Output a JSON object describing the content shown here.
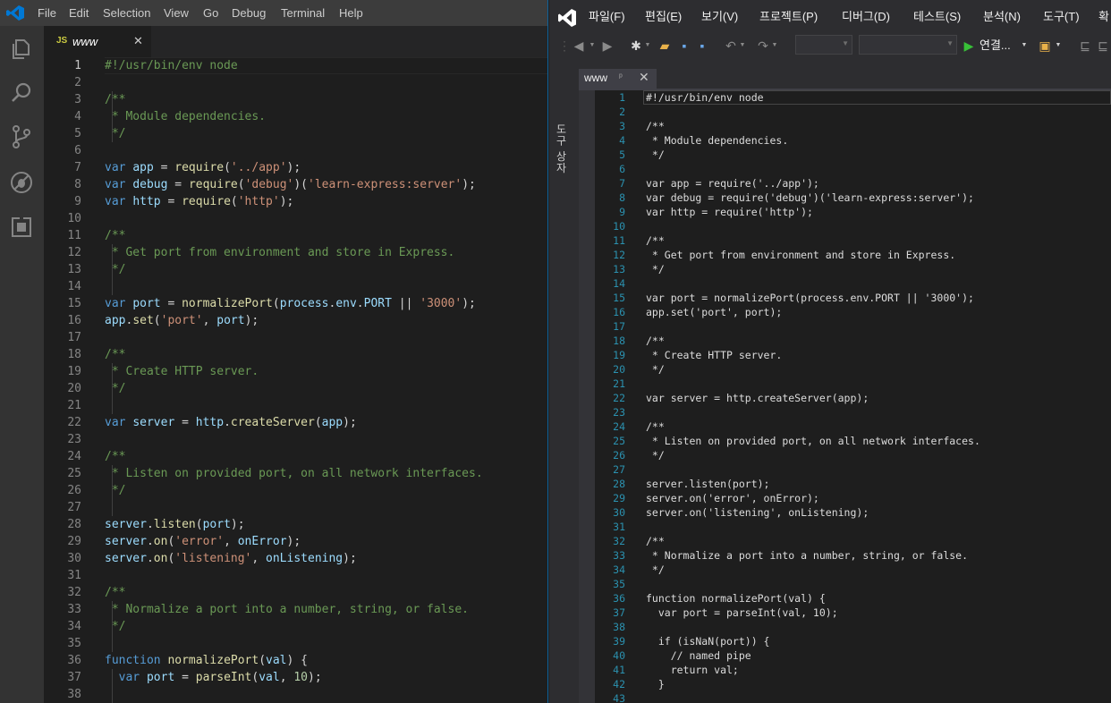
{
  "vscode": {
    "menu": [
      "File",
      "Edit",
      "Selection",
      "View",
      "Go",
      "Debug",
      "Terminal",
      "Help"
    ],
    "activity_icons": [
      "explorer-icon",
      "search-icon",
      "source-control-icon",
      "debug-icon",
      "extensions-icon"
    ],
    "tab": {
      "lang_badge": "JS",
      "name": "www",
      "close": "✕"
    },
    "current_line": 1,
    "lines": [
      {
        "n": "1",
        "c": [
          [
            "#!/usr/bin/env node",
            "#6a9955"
          ]
        ]
      },
      {
        "n": "2",
        "c": []
      },
      {
        "n": "3",
        "c": [
          [
            "/**",
            "#6a9955"
          ]
        ]
      },
      {
        "n": "4",
        "c": [
          [
            " * Module dependencies.",
            "#6a9955"
          ]
        ]
      },
      {
        "n": "5",
        "c": [
          [
            " */",
            "#6a9955"
          ]
        ]
      },
      {
        "n": "6",
        "c": []
      },
      {
        "n": "7",
        "c": [
          [
            "var",
            "#569cd6"
          ],
          [
            " ",
            "#d4d4d4"
          ],
          [
            "app",
            "#9cdcfe"
          ],
          [
            " = ",
            "#d4d4d4"
          ],
          [
            "require",
            "#dcdcaa"
          ],
          [
            "(",
            "#d4d4d4"
          ],
          [
            "'../app'",
            "#ce9178"
          ],
          [
            ");",
            "#d4d4d4"
          ]
        ]
      },
      {
        "n": "8",
        "c": [
          [
            "var",
            "#569cd6"
          ],
          [
            " ",
            "#d4d4d4"
          ],
          [
            "debug",
            "#9cdcfe"
          ],
          [
            " = ",
            "#d4d4d4"
          ],
          [
            "require",
            "#dcdcaa"
          ],
          [
            "(",
            "#d4d4d4"
          ],
          [
            "'debug'",
            "#ce9178"
          ],
          [
            ")(",
            "#d4d4d4"
          ],
          [
            "'learn-express:server'",
            "#ce9178"
          ],
          [
            ");",
            "#d4d4d4"
          ]
        ]
      },
      {
        "n": "9",
        "c": [
          [
            "var",
            "#569cd6"
          ],
          [
            " ",
            "#d4d4d4"
          ],
          [
            "http",
            "#9cdcfe"
          ],
          [
            " = ",
            "#d4d4d4"
          ],
          [
            "require",
            "#dcdcaa"
          ],
          [
            "(",
            "#d4d4d4"
          ],
          [
            "'http'",
            "#ce9178"
          ],
          [
            ");",
            "#d4d4d4"
          ]
        ]
      },
      {
        "n": "10",
        "c": []
      },
      {
        "n": "11",
        "c": [
          [
            "/**",
            "#6a9955"
          ]
        ]
      },
      {
        "n": "12",
        "c": [
          [
            " * Get port from environment and store in Express.",
            "#6a9955"
          ]
        ]
      },
      {
        "n": "13",
        "c": [
          [
            " */",
            "#6a9955"
          ]
        ]
      },
      {
        "n": "14",
        "c": []
      },
      {
        "n": "15",
        "c": [
          [
            "var",
            "#569cd6"
          ],
          [
            " ",
            "#d4d4d4"
          ],
          [
            "port",
            "#9cdcfe"
          ],
          [
            " = ",
            "#d4d4d4"
          ],
          [
            "normalizePort",
            "#dcdcaa"
          ],
          [
            "(",
            "#d4d4d4"
          ],
          [
            "process",
            "#9cdcfe"
          ],
          [
            ".",
            "#d4d4d4"
          ],
          [
            "env",
            "#9cdcfe"
          ],
          [
            ".",
            "#d4d4d4"
          ],
          [
            "PORT",
            "#9cdcfe"
          ],
          [
            " || ",
            "#d4d4d4"
          ],
          [
            "'3000'",
            "#ce9178"
          ],
          [
            ");",
            "#d4d4d4"
          ]
        ]
      },
      {
        "n": "16",
        "c": [
          [
            "app",
            "#9cdcfe"
          ],
          [
            ".",
            "#d4d4d4"
          ],
          [
            "set",
            "#dcdcaa"
          ],
          [
            "(",
            "#d4d4d4"
          ],
          [
            "'port'",
            "#ce9178"
          ],
          [
            ", ",
            "#d4d4d4"
          ],
          [
            "port",
            "#9cdcfe"
          ],
          [
            ");",
            "#d4d4d4"
          ]
        ]
      },
      {
        "n": "17",
        "c": []
      },
      {
        "n": "18",
        "c": [
          [
            "/**",
            "#6a9955"
          ]
        ]
      },
      {
        "n": "19",
        "c": [
          [
            " * Create HTTP server.",
            "#6a9955"
          ]
        ]
      },
      {
        "n": "20",
        "c": [
          [
            " */",
            "#6a9955"
          ]
        ]
      },
      {
        "n": "21",
        "c": []
      },
      {
        "n": "22",
        "c": [
          [
            "var",
            "#569cd6"
          ],
          [
            " ",
            "#d4d4d4"
          ],
          [
            "server",
            "#9cdcfe"
          ],
          [
            " = ",
            "#d4d4d4"
          ],
          [
            "http",
            "#9cdcfe"
          ],
          [
            ".",
            "#d4d4d4"
          ],
          [
            "createServer",
            "#dcdcaa"
          ],
          [
            "(",
            "#d4d4d4"
          ],
          [
            "app",
            "#9cdcfe"
          ],
          [
            ");",
            "#d4d4d4"
          ]
        ]
      },
      {
        "n": "23",
        "c": []
      },
      {
        "n": "24",
        "c": [
          [
            "/**",
            "#6a9955"
          ]
        ]
      },
      {
        "n": "25",
        "c": [
          [
            " * Listen on provided port, on all network interfaces.",
            "#6a9955"
          ]
        ]
      },
      {
        "n": "26",
        "c": [
          [
            " */",
            "#6a9955"
          ]
        ]
      },
      {
        "n": "27",
        "c": []
      },
      {
        "n": "28",
        "c": [
          [
            "server",
            "#9cdcfe"
          ],
          [
            ".",
            "#d4d4d4"
          ],
          [
            "listen",
            "#dcdcaa"
          ],
          [
            "(",
            "#d4d4d4"
          ],
          [
            "port",
            "#9cdcfe"
          ],
          [
            ");",
            "#d4d4d4"
          ]
        ]
      },
      {
        "n": "29",
        "c": [
          [
            "server",
            "#9cdcfe"
          ],
          [
            ".",
            "#d4d4d4"
          ],
          [
            "on",
            "#dcdcaa"
          ],
          [
            "(",
            "#d4d4d4"
          ],
          [
            "'error'",
            "#ce9178"
          ],
          [
            ", ",
            "#d4d4d4"
          ],
          [
            "onError",
            "#9cdcfe"
          ],
          [
            ");",
            "#d4d4d4"
          ]
        ]
      },
      {
        "n": "30",
        "c": [
          [
            "server",
            "#9cdcfe"
          ],
          [
            ".",
            "#d4d4d4"
          ],
          [
            "on",
            "#dcdcaa"
          ],
          [
            "(",
            "#d4d4d4"
          ],
          [
            "'listening'",
            "#ce9178"
          ],
          [
            ", ",
            "#d4d4d4"
          ],
          [
            "onListening",
            "#9cdcfe"
          ],
          [
            ");",
            "#d4d4d4"
          ]
        ]
      },
      {
        "n": "31",
        "c": []
      },
      {
        "n": "32",
        "c": [
          [
            "/**",
            "#6a9955"
          ]
        ]
      },
      {
        "n": "33",
        "c": [
          [
            " * Normalize a port into a number, string, or false.",
            "#6a9955"
          ]
        ]
      },
      {
        "n": "34",
        "c": [
          [
            " */",
            "#6a9955"
          ]
        ]
      },
      {
        "n": "35",
        "c": []
      },
      {
        "n": "36",
        "c": [
          [
            "function",
            "#569cd6"
          ],
          [
            " ",
            "#d4d4d4"
          ],
          [
            "normalizePort",
            "#dcdcaa"
          ],
          [
            "(",
            "#d4d4d4"
          ],
          [
            "val",
            "#9cdcfe"
          ],
          [
            ") {",
            "#d4d4d4"
          ]
        ]
      },
      {
        "n": "37",
        "c": [
          [
            "  ",
            "#d4d4d4"
          ],
          [
            "var",
            "#569cd6"
          ],
          [
            " ",
            "#d4d4d4"
          ],
          [
            "port",
            "#9cdcfe"
          ],
          [
            " = ",
            "#d4d4d4"
          ],
          [
            "parseInt",
            "#dcdcaa"
          ],
          [
            "(",
            "#d4d4d4"
          ],
          [
            "val",
            "#9cdcfe"
          ],
          [
            ", ",
            "#d4d4d4"
          ],
          [
            "10",
            "#b5cea8"
          ],
          [
            ");",
            "#d4d4d4"
          ]
        ]
      },
      {
        "n": "38",
        "c": []
      }
    ]
  },
  "vs": {
    "menu": [
      "파일(F)",
      "편집(E)",
      "보기(V)",
      "프로젝트(P)",
      "디버그(D)",
      "테스트(S)",
      "분석(N)",
      "도구(T)",
      "확"
    ],
    "toolbar": {
      "run_label": "연결...",
      "combo1": "",
      "combo2": ""
    },
    "toolbox_label": "도구 상자",
    "tab": {
      "name": "www",
      "pin": "ᵖ",
      "close": "✕"
    },
    "current_line": 1,
    "lines": [
      {
        "n": "1",
        "t": "#!/usr/bin/env node"
      },
      {
        "n": "2",
        "t": ""
      },
      {
        "n": "3",
        "t": "/**"
      },
      {
        "n": "4",
        "t": " * Module dependencies."
      },
      {
        "n": "5",
        "t": " */"
      },
      {
        "n": "6",
        "t": ""
      },
      {
        "n": "7",
        "t": "var app = require('../app');"
      },
      {
        "n": "8",
        "t": "var debug = require('debug')('learn-express:server');"
      },
      {
        "n": "9",
        "t": "var http = require('http');"
      },
      {
        "n": "10",
        "t": ""
      },
      {
        "n": "11",
        "t": "/**"
      },
      {
        "n": "12",
        "t": " * Get port from environment and store in Express."
      },
      {
        "n": "13",
        "t": " */"
      },
      {
        "n": "14",
        "t": ""
      },
      {
        "n": "15",
        "t": "var port = normalizePort(process.env.PORT || '3000');"
      },
      {
        "n": "16",
        "t": "app.set('port', port);"
      },
      {
        "n": "17",
        "t": ""
      },
      {
        "n": "18",
        "t": "/**"
      },
      {
        "n": "19",
        "t": " * Create HTTP server."
      },
      {
        "n": "20",
        "t": " */"
      },
      {
        "n": "21",
        "t": ""
      },
      {
        "n": "22",
        "t": "var server = http.createServer(app);"
      },
      {
        "n": "23",
        "t": ""
      },
      {
        "n": "24",
        "t": "/**"
      },
      {
        "n": "25",
        "t": " * Listen on provided port, on all network interfaces."
      },
      {
        "n": "26",
        "t": " */"
      },
      {
        "n": "27",
        "t": ""
      },
      {
        "n": "28",
        "t": "server.listen(port);"
      },
      {
        "n": "29",
        "t": "server.on('error', onError);"
      },
      {
        "n": "30",
        "t": "server.on('listening', onListening);"
      },
      {
        "n": "31",
        "t": ""
      },
      {
        "n": "32",
        "t": "/**"
      },
      {
        "n": "33",
        "t": " * Normalize a port into a number, string, or false."
      },
      {
        "n": "34",
        "t": " */"
      },
      {
        "n": "35",
        "t": ""
      },
      {
        "n": "36",
        "t": "function normalizePort(val) {"
      },
      {
        "n": "37",
        "t": "  var port = parseInt(val, 10);"
      },
      {
        "n": "38",
        "t": ""
      },
      {
        "n": "39",
        "t": "  if (isNaN(port)) {"
      },
      {
        "n": "40",
        "t": "    // named pipe"
      },
      {
        "n": "41",
        "t": "    return val;"
      },
      {
        "n": "42",
        "t": "  }"
      },
      {
        "n": "43",
        "t": ""
      }
    ]
  }
}
